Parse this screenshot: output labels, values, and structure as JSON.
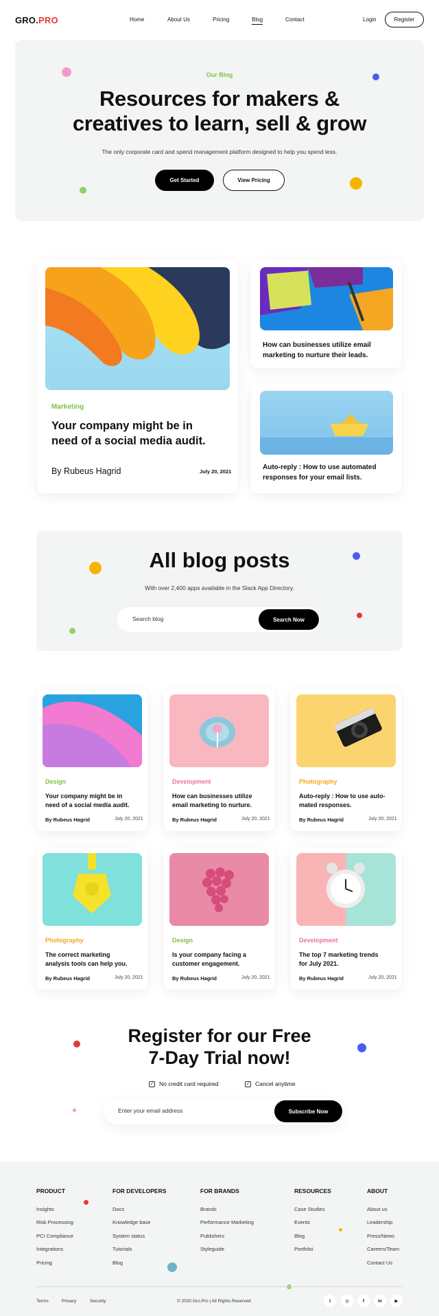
{
  "nav": {
    "logo_main": "GRO.",
    "logo_accent": "PRO",
    "links": [
      "Home",
      "About Us",
      "Pricing",
      "Blog",
      "Contact"
    ],
    "login": "Login",
    "register": "Register"
  },
  "hero": {
    "eyebrow": "Our Blog",
    "title_line1": "Resources for makers &",
    "title_line2": "creatives to learn, sell & grow",
    "subtitle": "The only corporate card and spend management platform designed to help you spend less.",
    "primary_button": "Get Started",
    "secondary_button": "View Pricing"
  },
  "featured": {
    "main": {
      "category": "Marketing",
      "title_line1": "Your company might be in",
      "title_line2": "need of a social media audit.",
      "author": "By Rubeus Hagrid",
      "date": "July 20, 2021"
    },
    "side": [
      {
        "title_line1": "How can businesses utilize email",
        "title_line2": "marketing to nurture their leads."
      },
      {
        "title_line1": "Auto-reply : How to use automated",
        "title_line2": "responses for your email lists."
      }
    ]
  },
  "blog": {
    "title": "All blog posts",
    "subtitle": "With over 2,400 apps available in the Slack App Directory.",
    "search_placeholder": "Search blog",
    "search_button": "Search Now"
  },
  "posts": [
    {
      "category": "Design",
      "title_line1": "Your company might be in",
      "title_line2": "need of a social media audit.",
      "author": "By Rubeus Hagrid",
      "date": "July 20, 2021",
      "cat_color": "#7dc243"
    },
    {
      "category": "Development",
      "title_line1": "How can businesses utilize",
      "title_line2": "email marketing to nurture.",
      "author": "By Rubeus Hagrid",
      "date": "July 20, 2021",
      "cat_color": "#f06fa4"
    },
    {
      "category": "Photography",
      "title_line1": "Auto-reply : How to use auto-",
      "title_line2": "mated responses.",
      "author": "By Rubeus Hagrid",
      "date": "July 20, 2021",
      "cat_color": "#f5a623"
    },
    {
      "category": "Photography",
      "title_line1": "The correct marketing",
      "title_line2": "analysis tools can help you.",
      "author": "By Rubeus Hagrid",
      "date": "July 20, 2021",
      "cat_color": "#f5a623"
    },
    {
      "category": "Design",
      "title_line1": "Is your company facing a",
      "title_line2": "customer engagement.",
      "author": "By Rubeus Hagrid",
      "date": "July 20, 2021",
      "cat_color": "#7dc243"
    },
    {
      "category": "Development",
      "title_line1": "The top 7 marketing trends",
      "title_line2": "for July 2021.",
      "author": "By Rubeus Hagrid",
      "date": "July 20, 2021",
      "cat_color": "#f06fa4"
    }
  ],
  "register": {
    "title_line1": "Register for our Free",
    "title_line2": "7-Day Trial now!",
    "check1": "No credit card required",
    "check2": "Cancel anytime",
    "email_placeholder": "Enter your email address",
    "subscribe_button": "Subscribe Now"
  },
  "footer": {
    "columns": [
      {
        "heading": "PRODUCT",
        "links": [
          "Insights",
          "Risk Processing",
          "PCI Compliance",
          "Integrations",
          "Pricing"
        ]
      },
      {
        "heading": "FOR DEVELOPERS",
        "links": [
          "Docs",
          "Knowledge base",
          "System status",
          "Tutorials",
          "Blog"
        ]
      },
      {
        "heading": "FOR BRANDS",
        "links": [
          "Brands",
          "Performance Marketing",
          "Publishers",
          "Styleguide"
        ]
      },
      {
        "heading": "RESOURCES",
        "links": [
          "Case Studies",
          "Events",
          "Blog",
          "Portfoloi"
        ]
      },
      {
        "heading": "ABOUT",
        "links": [
          "About us",
          "Leadership",
          "Press/News",
          "Careers/Team",
          "Contact Us"
        ]
      }
    ],
    "bottom_links": [
      "Terms",
      "Privacy",
      "Security"
    ],
    "copyright": "© 2020 Gro.Pro | All Rights Reserved",
    "social_icons": [
      "twitter-icon",
      "instagram-icon",
      "facebook-icon",
      "linkedin-icon",
      "youtube-icon"
    ]
  },
  "colors": {
    "accent_green": "#7dc243",
    "accent_red": "#e53935",
    "accent_blue": "#4a5cf0",
    "accent_yellow": "#f5b400",
    "accent_pink": "#f06fa4"
  }
}
